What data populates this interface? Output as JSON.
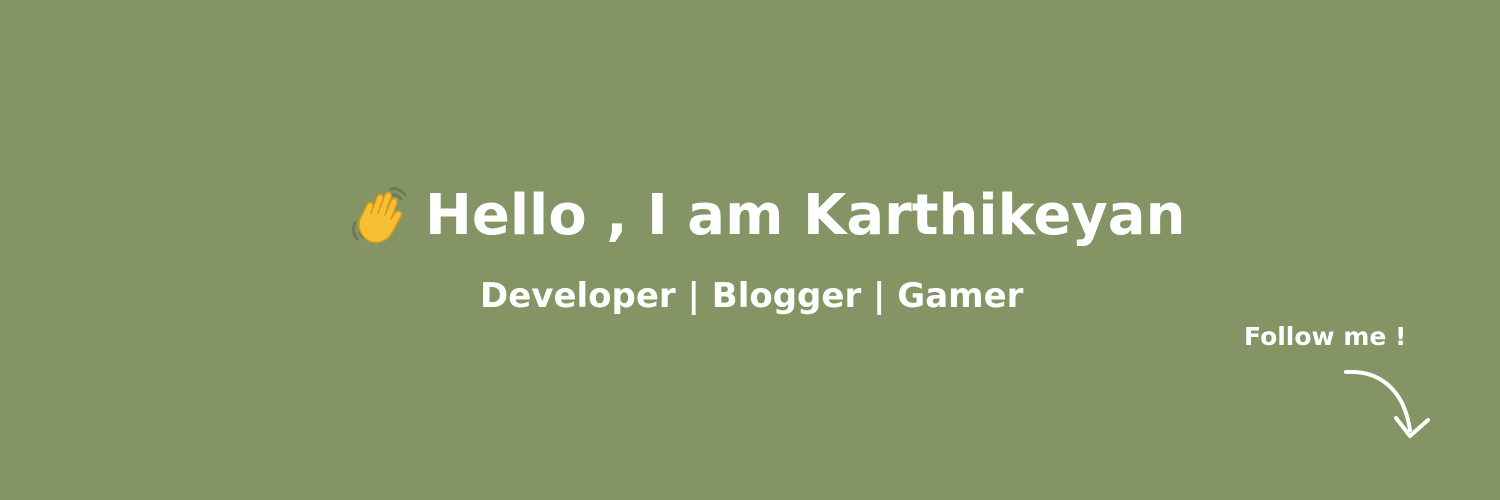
{
  "banner": {
    "background_color": "#849464",
    "wave_icon": "waving-hand-icon",
    "title": "Hello , I am Karthikeyan",
    "tagline": "Developer | Blogger | Gamer",
    "follow_text": "Follow me !",
    "arrow_icon": "curved-arrow-down-icon"
  }
}
